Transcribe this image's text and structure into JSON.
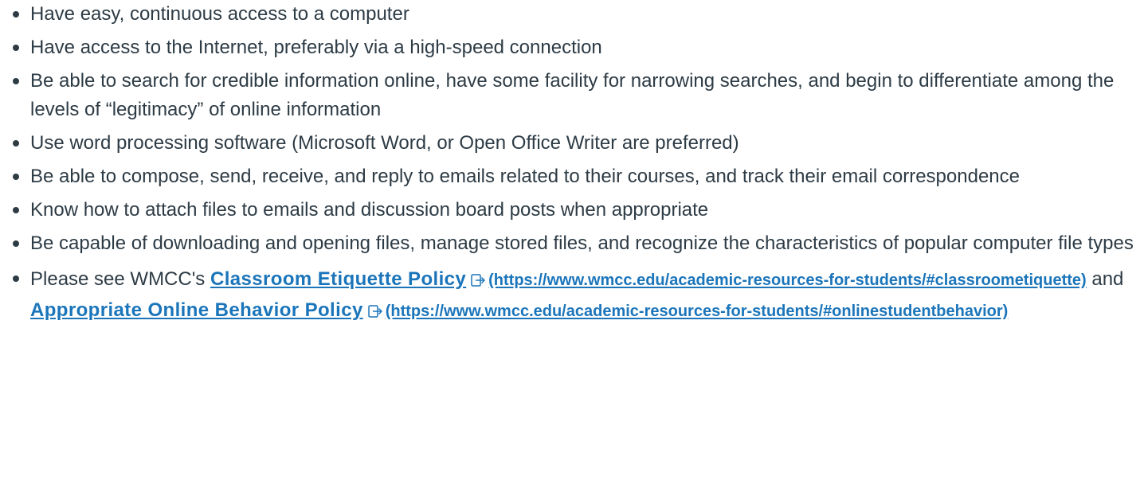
{
  "items": [
    "Have easy, continuous access to a computer",
    "Have access to the Internet, preferably via a high-speed connection",
    "Be able to search for credible information online, have some facility for narrowing searches, and begin to differentiate among the levels of “legitimacy” of online information",
    "Use word processing software (Microsoft Word, or Open Office Writer are preferred)",
    "Be able to compose, send, receive, and reply to emails related to their courses, and track their email correspondence",
    "Know how to attach files to emails and discussion board posts when appropriate",
    "Be capable of downloading and opening files, manage stored files, and recognize the characteristics of popular computer file types"
  ],
  "policy": {
    "prefix": "Please see WMCC's ",
    "link1_label": "Classroom Etiquette Policy",
    "link1_url_text": "(https://www.wmcc.edu/academic-resources-for-students/#classroometiquette)",
    "middle": " and ",
    "link2_label": "Appropriate Online Behavior Policy",
    "link2_url_text": "(https://www.wmcc.edu/academic-resources-for-students/#onlinestudentbehavior)"
  },
  "icons": {
    "external_link": "external-link-icon"
  },
  "colors": {
    "text": "#2d3b45",
    "link": "#1b75ba"
  }
}
